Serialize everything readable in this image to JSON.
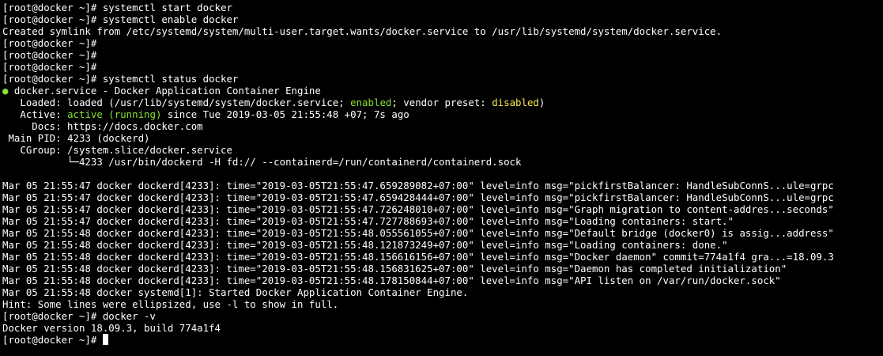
{
  "terminal": {
    "prompt": "[root@docker ~]# ",
    "colors": {
      "background": "#000000",
      "foreground": "#ffffff",
      "green": "#8ae234",
      "yellow": "#fce94f"
    },
    "lines": {
      "l01": "[root@docker ~]# systemctl start docker",
      "l02": "[root@docker ~]# systemctl enable docker",
      "l03": "Created symlink from /etc/systemd/system/multi-user.target.wants/docker.service to /usr/lib/systemd/system/docker.service.",
      "l04": "[root@docker ~]#",
      "l05": "[root@docker ~]#",
      "l06": "[root@docker ~]#",
      "l07": "[root@docker ~]# systemctl status docker",
      "status": {
        "bullet": "●",
        "title": " docker.service - Docker Application Container Engine",
        "loaded_label": "   Loaded: loaded (/usr/lib/systemd/system/docker.service; ",
        "loaded_enabled": "enabled",
        "loaded_mid": "; vendor preset: ",
        "loaded_disabled": "disabled",
        "loaded_end": ")",
        "active_label": "   Active: ",
        "active_state": "active (running)",
        "active_rest": " since Tue 2019-03-05 21:55:48 +07; 7s ago",
        "docs": "     Docs: https://docs.docker.com",
        "mainpid": " Main PID: 4233 (dockerd)",
        "cgroup": "   CGroup: /system.slice/docker.service",
        "cgroup_child": "           └─4233 /usr/bin/dockerd -H fd:// --containerd=/run/containerd/containerd.sock"
      },
      "logs": [
        "Mar 05 21:55:47 docker dockerd[4233]: time=\"2019-03-05T21:55:47.659289082+07:00\" level=info msg=\"pickfirstBalancer: HandleSubConnS...ule=grpc",
        "Mar 05 21:55:47 docker dockerd[4233]: time=\"2019-03-05T21:55:47.659428444+07:00\" level=info msg=\"pickfirstBalancer: HandleSubConnS...ule=grpc",
        "Mar 05 21:55:47 docker dockerd[4233]: time=\"2019-03-05T21:55:47.726248010+07:00\" level=info msg=\"Graph migration to content-addres...seconds\"",
        "Mar 05 21:55:47 docker dockerd[4233]: time=\"2019-03-05T21:55:47.727788693+07:00\" level=info msg=\"Loading containers: start.\"",
        "Mar 05 21:55:48 docker dockerd[4233]: time=\"2019-03-05T21:55:48.055561055+07:00\" level=info msg=\"Default bridge (docker0) is assig...address\"",
        "Mar 05 21:55:48 docker dockerd[4233]: time=\"2019-03-05T21:55:48.121873249+07:00\" level=info msg=\"Loading containers: done.\"",
        "Mar 05 21:55:48 docker dockerd[4233]: time=\"2019-03-05T21:55:48.156616156+07:00\" level=info msg=\"Docker daemon\" commit=774a1f4 gra...=18.09.3",
        "Mar 05 21:55:48 docker dockerd[4233]: time=\"2019-03-05T21:55:48.156831625+07:00\" level=info msg=\"Daemon has completed initialization\"",
        "Mar 05 21:55:48 docker dockerd[4233]: time=\"2019-03-05T21:55:48.178150844+07:00\" level=info msg=\"API listen on /var/run/docker.sock\"",
        "Mar 05 21:55:48 docker systemd[1]: Started Docker Application Container Engine."
      ],
      "hint": "Hint: Some lines were ellipsized, use -l to show in full.",
      "l_docker_v": "[root@docker ~]# docker -v",
      "docker_version": "Docker version 18.09.3, build 774a1f4",
      "last_prompt": "[root@docker ~]# "
    }
  }
}
